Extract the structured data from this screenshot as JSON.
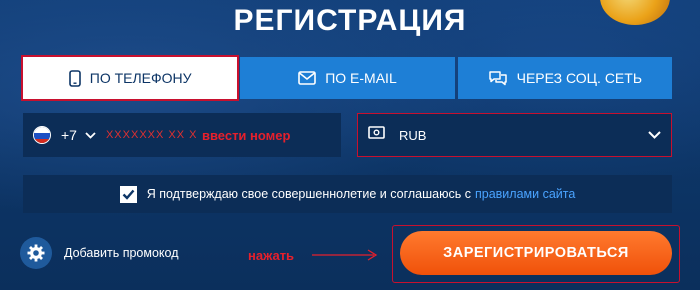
{
  "title": "РЕГИСТРАЦИЯ",
  "tabs": [
    {
      "label": "ПО ТЕЛЕФОНУ",
      "icon": "phone-icon"
    },
    {
      "label": "ПО E-MAIL",
      "icon": "mail-icon"
    },
    {
      "label": "ЧЕРЕЗ СОЦ. СЕТЬ",
      "icon": "chat-icon"
    }
  ],
  "phone": {
    "country_code": "+7",
    "placeholder": "XXXXXXX XX XX",
    "annotation": "ввести номер"
  },
  "currency": {
    "value": "RUB"
  },
  "agreement": {
    "checked": true,
    "text": "Я подтверждаю свое совершеннолетие и соглашаюсь с",
    "link": "правилами сайта"
  },
  "promo": {
    "label": "Добавить промокод"
  },
  "annotation_press": "нажать",
  "register_button": "ЗАРЕГИСТРИРОВАТЬСЯ",
  "colors": {
    "background": "#0e3a70",
    "tab_blue": "#1e7fd6",
    "field_bg": "#0c2d57",
    "accent_orange": "#f0510a",
    "annotation_red": "#e6202c",
    "link_blue": "#4aa3ff"
  }
}
